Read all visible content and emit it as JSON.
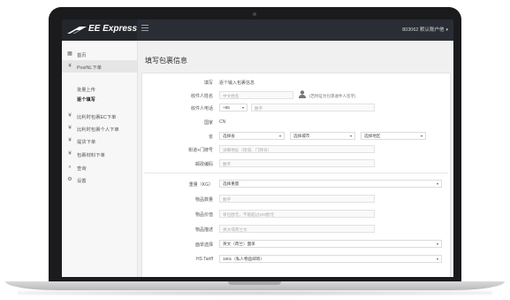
{
  "header": {
    "logo_text": "EE Express",
    "user_menu": "803062 默认账户他",
    "user_caret": "▾"
  },
  "sidebar": {
    "items": [
      {
        "icon": "grid-icon",
        "glyph": "▦",
        "label": "首页"
      },
      {
        "icon": "currency-icon",
        "glyph": "¥",
        "label": "PostNL下单"
      },
      {
        "icon": "currency-icon",
        "glyph": "¥",
        "label": "比利时包裹EC下单"
      },
      {
        "icon": "currency-icon",
        "glyph": "¥",
        "label": "比利时包裹个人下单"
      },
      {
        "icon": "currency-icon",
        "glyph": "¥",
        "label": "提货下单"
      },
      {
        "icon": "currency-icon",
        "glyph": "¥",
        "label": "包裹材料下单"
      },
      {
        "icon": "search-icon",
        "glyph": "⌕",
        "label": "查询"
      },
      {
        "icon": "gear-icon",
        "glyph": "⚙",
        "label": "设置"
      }
    ],
    "sub_items": [
      {
        "label": "批量上传"
      },
      {
        "label": "逐个填写"
      }
    ]
  },
  "main": {
    "page_title": "填写包裹信息",
    "form": {
      "note_label": "填写",
      "note_text": "逐个输入包裹信息",
      "recipient_name_label": "收件人姓名",
      "recipient_name_placeholder": "中文姓名",
      "recipient_name_hint": "(若例证为包裹收件人签字)",
      "recipient_phone_label": "收件人电话",
      "phone_code": "+86",
      "phone_placeholder": "数字",
      "country_label": "国家",
      "country_value": "CN",
      "province_label": "省",
      "province_select": "选择省",
      "city_select": "选择城市",
      "district_select": "选择地区",
      "street_label": "街道+门牌号",
      "street_placeholder": "详细地址（街道、门牌号）",
      "postcode_label": "邮政编码",
      "postcode_placeholder": "数字",
      "weight_label": "重量（KG）",
      "weight_select": "选择重量",
      "qty_label": "物品数量",
      "qty_placeholder": "数字",
      "value_label": "物品价值",
      "value_placeholder": "单位欧元，不能超过200欧元",
      "desc_label": "物品描述",
      "desc_placeholder": "英文或荷兰文",
      "lang_label": "面单选择",
      "lang_select": "英文（荷兰）面单",
      "hs_label": "HS Tariff",
      "hs_select": "1901（私人物品邮寄）"
    }
  }
}
